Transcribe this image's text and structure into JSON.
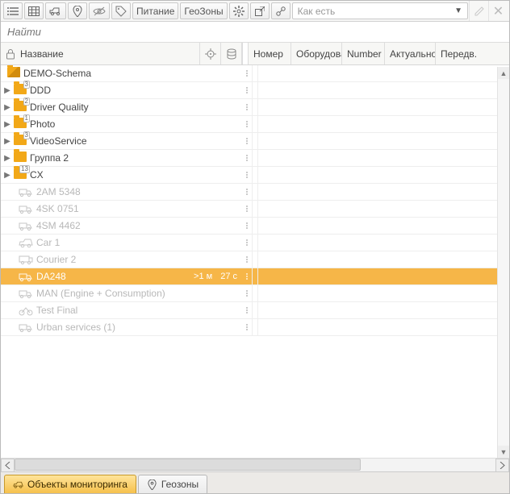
{
  "toolbar": {
    "btn_power": "Питание",
    "btn_geo": "ГеоЗоны",
    "dropdown_value": "Как есть"
  },
  "search": {
    "placeholder": "Найти"
  },
  "columns": {
    "name": "Название",
    "num": "Номер",
    "equip": "Оборудова...",
    "number": "Number",
    "actual": "Актуально...",
    "pred": "Передв."
  },
  "tree": {
    "root": {
      "label": "DEMO-Schema"
    },
    "folders": [
      {
        "badge": "3",
        "label": "DDD"
      },
      {
        "badge": "2",
        "label": "Driver Quality"
      },
      {
        "badge": "1",
        "label": "Photo"
      },
      {
        "badge": "3",
        "label": "VideoService"
      },
      {
        "badge": "",
        "label": "Группа 2"
      },
      {
        "badge": "13",
        "label": "CX"
      }
    ],
    "vehicles": [
      {
        "label": "2AM 5348",
        "kind": "truck"
      },
      {
        "label": "4SK 0751",
        "kind": "truck"
      },
      {
        "label": "4SM 4462",
        "kind": "truck"
      },
      {
        "label": "Car 1",
        "kind": "car"
      },
      {
        "label": "Courier 2",
        "kind": "van"
      },
      {
        "label": "DA248",
        "kind": "truck",
        "selected": true,
        "time1": ">1 м",
        "time2": "27 с"
      },
      {
        "label": "MAN (Engine + Consumption)",
        "kind": "truck"
      },
      {
        "label": "Test Final",
        "kind": "moto"
      },
      {
        "label": "Urban services (1)",
        "kind": "service"
      }
    ]
  },
  "tabs": {
    "objects": "Объекты мониторинга",
    "geo": "Геозоны"
  }
}
